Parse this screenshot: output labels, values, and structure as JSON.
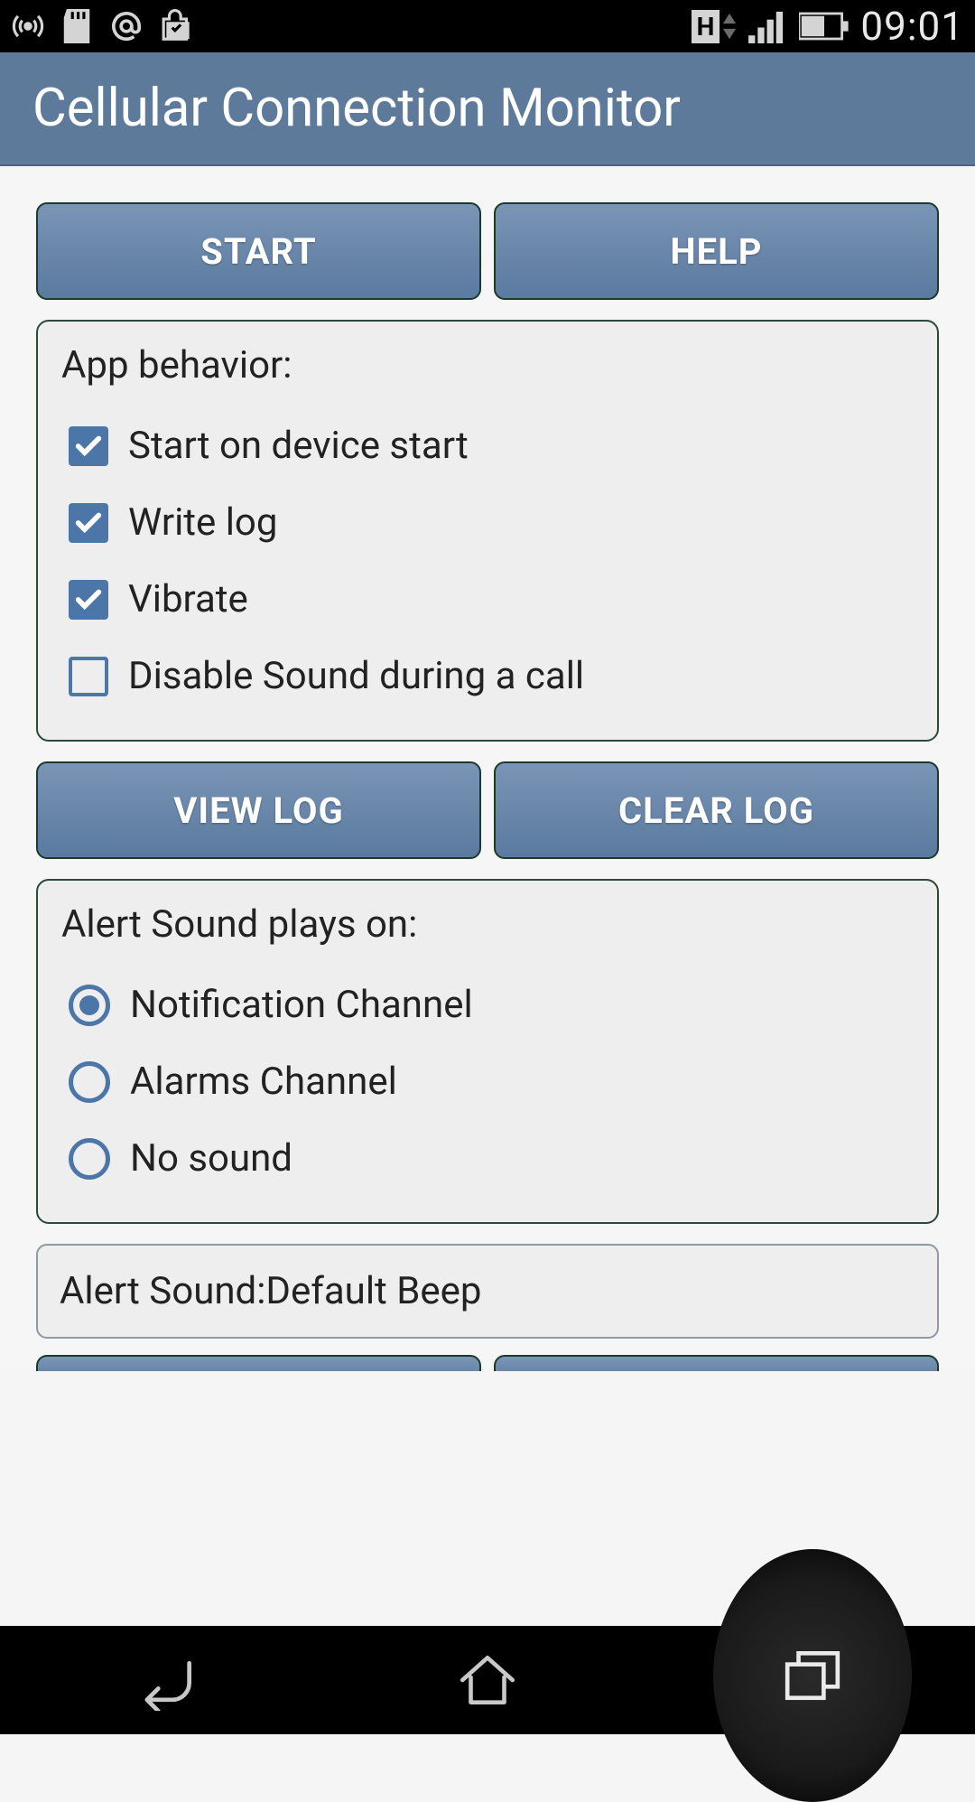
{
  "statusbar": {
    "h_indicator": "H",
    "time": "09:01"
  },
  "header": {
    "title": "Cellular Connection Monitor"
  },
  "buttons": {
    "start": "START",
    "help": "HELP",
    "view_log": "VIEW LOG",
    "clear_log": "CLEAR LOG"
  },
  "behavior": {
    "title": "App behavior:",
    "items": [
      {
        "label": "Start on device start",
        "checked": true
      },
      {
        "label": "Write log",
        "checked": true
      },
      {
        "label": "Vibrate",
        "checked": true
      },
      {
        "label": "Disable Sound during a call",
        "checked": false
      }
    ]
  },
  "alert_channel": {
    "title": "Alert Sound plays on:",
    "items": [
      {
        "label": "Notification Channel",
        "selected": true
      },
      {
        "label": "Alarms Channel",
        "selected": false
      },
      {
        "label": "No sound",
        "selected": false
      }
    ]
  },
  "alert_sound": {
    "label": "Alert Sound:Default Beep"
  }
}
